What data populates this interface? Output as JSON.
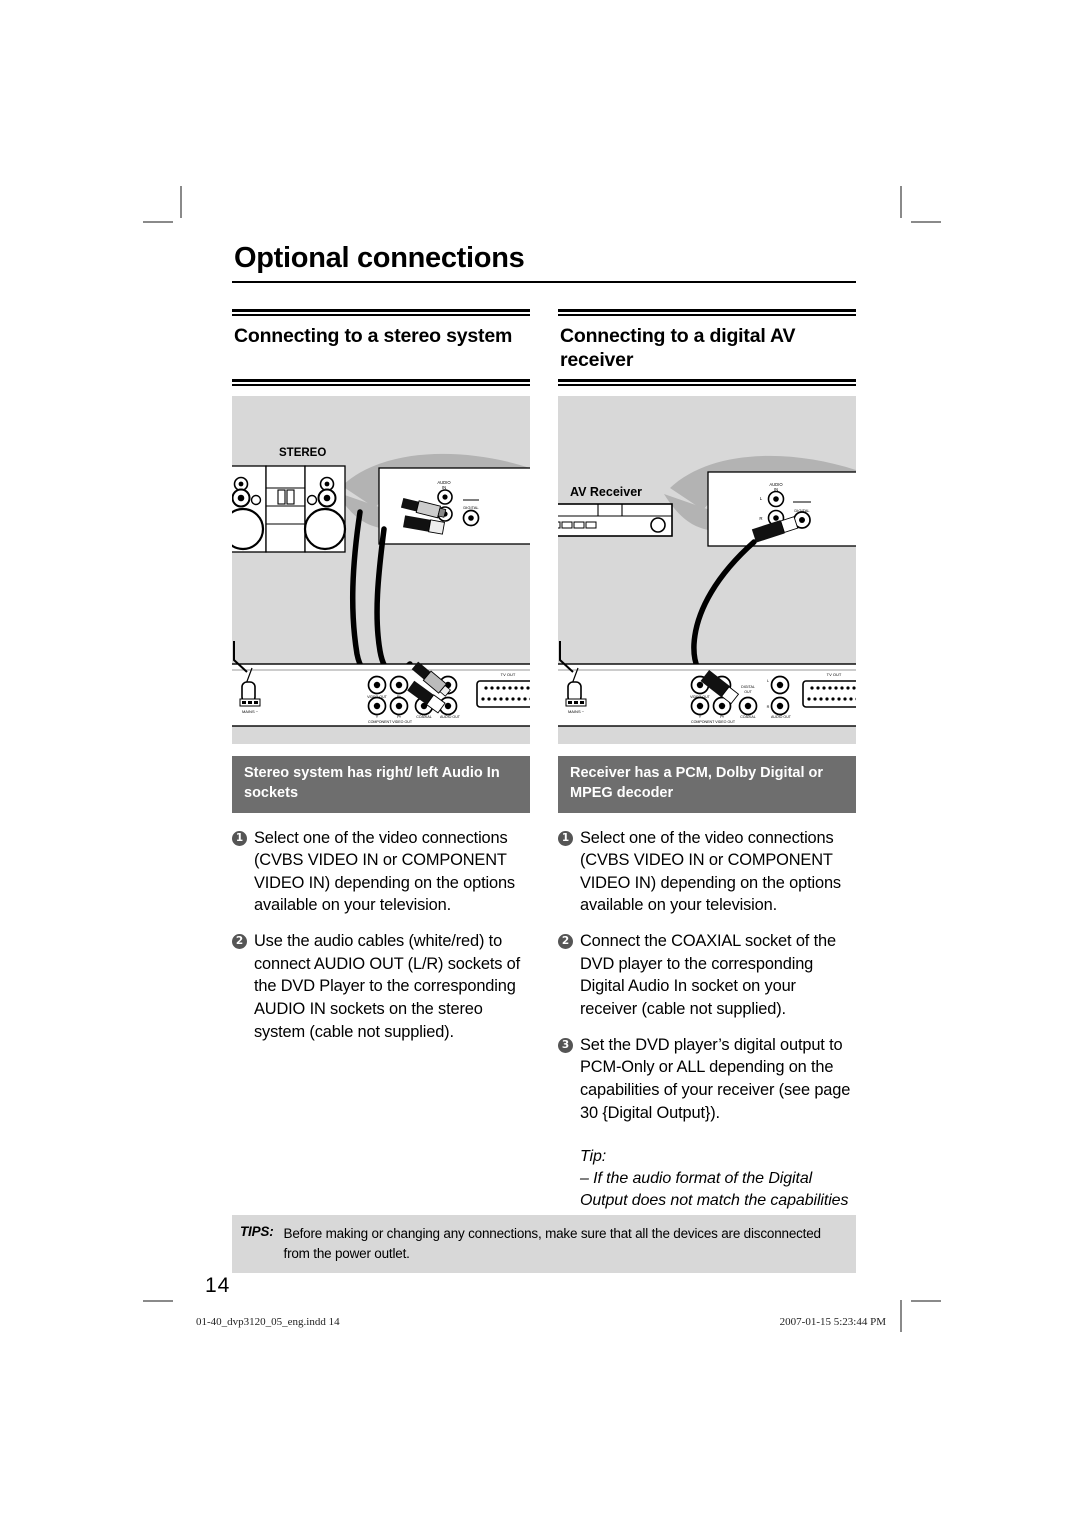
{
  "document": {
    "title": "Optional connections",
    "page_number": "14",
    "footer": {
      "file_name": "01-40_dvp3120_05_eng.indd   14",
      "timestamp": "2007-01-15   5:23:44 PM"
    }
  },
  "columns": [
    {
      "id": "stereo",
      "subheading": "Connecting to a stereo system",
      "figure": {
        "device_label": "STEREO",
        "device_panel_labels": [
          "AUDIO IN",
          "DIGITAL"
        ],
        "dvd_panel_labels": [
          "MAINS ~",
          "VIDEO OUT",
          "Pb",
          "Pr",
          "Y",
          "COMPONENT VIDEO OUT",
          "COAXIAL",
          "AUDIO OUT",
          "TV OUT"
        ]
      },
      "band": "Stereo system has right/ left Audio In sockets",
      "steps": [
        {
          "num": "1",
          "text": "Select one of the video connections (CVBS VIDEO IN or COMPONENT VIDEO IN) depending on the options available on your television."
        },
        {
          "num": "2",
          "text": "Use the audio cables (white/red) to connect AUDIO OUT (L/R) sockets of the DVD Player to the corresponding AUDIO IN sockets on the stereo system (cable not supplied)."
        }
      ],
      "tip": null
    },
    {
      "id": "av-receiver",
      "subheading": "Connecting to a digital AV receiver",
      "figure": {
        "device_label": "AV Receiver",
        "device_panel_labels": [
          "AUDIO IN",
          "L",
          "R",
          "DIGITAL"
        ],
        "dvd_panel_labels": [
          "MAINS ~",
          "VIDEO OUT",
          "Pb",
          "Pr",
          "Y",
          "COMPONENT VIDEO OUT",
          "DIGITAL OUT",
          "COAXIAL",
          "L",
          "R",
          "AUDIO OUT",
          "TV OUT"
        ]
      },
      "band": "Receiver has a PCM, Dolby Digital or MPEG decoder",
      "steps": [
        {
          "num": "1",
          "text": "Select one of the video connections (CVBS VIDEO IN or COMPONENT VIDEO IN) depending on the options available on your television."
        },
        {
          "num": "2",
          "text": "Connect the COAXIAL socket of the DVD player to the corresponding Digital Audio In socket on your receiver (cable not supplied)."
        },
        {
          "num": "3",
          "text": "Set the DVD player’s digital output to PCM-Only or ALL depending on the capabilities of your receiver (see page 30 {Digital Output})."
        }
      ],
      "tip": {
        "label": "Tip:",
        "text": "– If the audio format of the Digital Output does not match the capabilities of your receiver, the receiver will produce a strong, distorted sound or no sound at all."
      }
    }
  ],
  "tips_footer": {
    "label": "TIPS:",
    "text": "Before making or changing any connections, make sure that all the devices are disconnected from the power outlet."
  },
  "colors": {
    "figure_background": "#d8d8d8",
    "band_background": "#6e6e6e",
    "bullet_background": "#555555",
    "rule": "#000000"
  }
}
